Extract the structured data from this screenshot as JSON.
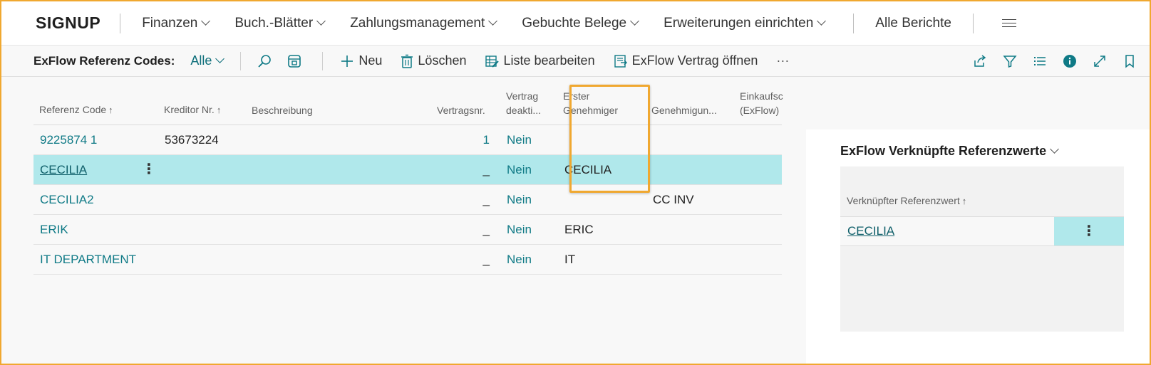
{
  "nav": {
    "brand": "SIGNUP",
    "items": [
      {
        "label": "Finanzen",
        "dropdown": true
      },
      {
        "label": "Buch.-Blätter",
        "dropdown": true
      },
      {
        "label": "Zahlungsmanagement",
        "dropdown": true
      },
      {
        "label": "Gebuchte Belege",
        "dropdown": true
      },
      {
        "label": "Erweiterungen einrichten",
        "dropdown": true
      }
    ],
    "all_reports": "Alle Berichte"
  },
  "actionbar": {
    "page_title": "ExFlow Referenz Codes:",
    "filter": "Alle",
    "new": "Neu",
    "delete": "Löschen",
    "edit_list": "Liste bearbeiten",
    "open_contract": "ExFlow Vertrag öffnen",
    "more": "···"
  },
  "table": {
    "headers": {
      "ref_code": "Referenz Code",
      "vendor_no": "Kreditor Nr.",
      "description": "Beschreibung",
      "contract_no": "Vertragsnr.",
      "contract_deact_1": "Vertrag",
      "contract_deact_2": "deakti...",
      "first_approver_1": "Erster",
      "first_approver_2": "Genehmiger",
      "approval": "Genehmigun...",
      "purchase_1": "Einkaufsc",
      "purchase_2": "(ExFlow)",
      "sort_arrow": "↑"
    },
    "rows": [
      {
        "ref_code": "9225874 1",
        "vendor_no": "53673224",
        "description": "",
        "contract_no": "1",
        "deactivated": "Nein",
        "first_approver": "",
        "approval": ""
      },
      {
        "ref_code": "CECILIA",
        "vendor_no": "",
        "description": "",
        "contract_no": "_",
        "deactivated": "Nein",
        "first_approver": "CECILIA",
        "approval": ""
      },
      {
        "ref_code": "CECILIA2",
        "vendor_no": "",
        "description": "",
        "contract_no": "_",
        "deactivated": "Nein",
        "first_approver": "",
        "approval": "CC INV"
      },
      {
        "ref_code": "ERIK",
        "vendor_no": "",
        "description": "",
        "contract_no": "_",
        "deactivated": "Nein",
        "first_approver": "ERIC",
        "approval": ""
      },
      {
        "ref_code": "IT DEPARTMENT",
        "vendor_no": "",
        "description": "",
        "contract_no": "_",
        "deactivated": "Nein",
        "first_approver": "IT",
        "approval": ""
      }
    ],
    "selected_row": 1,
    "kebab": "⋮"
  },
  "factbox": {
    "title": "ExFlow Verknüpfte Referenzwerte",
    "header": "Verknüpfter Referenzwert",
    "sort_arrow": "↑",
    "rows": [
      {
        "value": "CECILIA"
      }
    ],
    "kebab": "⋮"
  },
  "colors": {
    "accent": "#0f7a86",
    "selected_row": "#b0e8eb",
    "highlight_border": "#f0a830"
  }
}
